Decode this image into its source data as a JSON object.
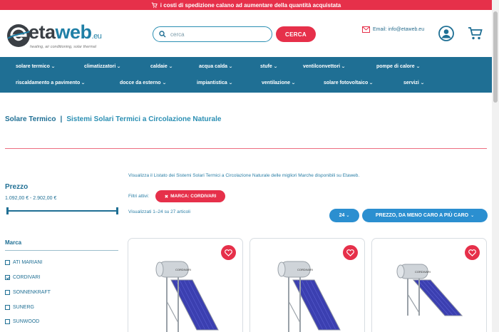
{
  "promo": {
    "text": "i costi di spedizione calano ad aumentare della quantità acquistata"
  },
  "header": {
    "logo_word_eta": "eta",
    "logo_word_web": "web",
    "logo_word_eu": ".eu",
    "logo_tagline": "heating, air conditioning, solar thermal",
    "search_placeholder": "cerca",
    "search_button": "CERCA",
    "email": "Email: info@etaweb.eu"
  },
  "nav": {
    "row1": [
      "solare termico",
      "climatizzatori",
      "caldaie",
      "acqua calda",
      "stufe",
      "ventilconvettori",
      "pompe di calore"
    ],
    "row2": [
      "riscaldamento a pavimento",
      "docce da esterno",
      "impiantistica",
      "ventilazione",
      "solare fotovoltaico",
      "servizi"
    ]
  },
  "breadcrumb": {
    "parent": "Solare Termico",
    "separator": "|",
    "current": "Sistemi Solari Termici a Circolazione Naturale"
  },
  "sidebar": {
    "price_title": "Prezzo",
    "price_range": "1.092,00 € - 2.902,00 €",
    "price_slider": {
      "min_fraction": 0.0,
      "max_fraction": 1.0
    },
    "brand_title": "Marca",
    "brands": [
      {
        "label": "ATI MARIANI",
        "checked": false
      },
      {
        "label": "CORDIVARI",
        "checked": true
      },
      {
        "label": "SONNENKRAFT",
        "checked": false
      },
      {
        "label": "SUNERG",
        "checked": false
      },
      {
        "label": "SUNWOOD",
        "checked": false
      }
    ]
  },
  "main": {
    "intro": "Visualizza il Listato dei Sistemi Solari Termici a Circolazione Naturale delle migliori Marche disponibili su Etaweb.",
    "filters_label": "Filtri attivi:",
    "active_filter": "MARCA: CORDIVARI",
    "results": "Visualizzati 1–24 su 27 articoli",
    "per_page": "24",
    "sort": "PREZZO, DA MENO CARO A PIÙ CARO",
    "products": [
      {
        "brand_label": "CORDIVARI"
      },
      {
        "brand_label": "CORDIVARI"
      },
      {
        "brand_label": "CORDIVARI"
      }
    ]
  },
  "colors": {
    "accent_red": "#e6304a",
    "nav_blue": "#1f6f94",
    "button_blue": "#2b8fd0"
  }
}
